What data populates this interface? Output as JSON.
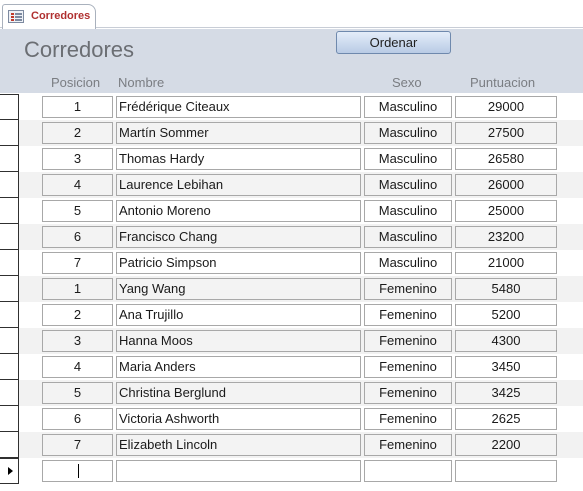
{
  "tab": {
    "label": "Corredores",
    "icon": "form-icon"
  },
  "form": {
    "title": "Corredores",
    "order_button": "Ordenar"
  },
  "columns": [
    "Posicion",
    "Nombre",
    "Sexo",
    "Puntuacion"
  ],
  "rows": [
    {
      "posicion": "1",
      "nombre": "Frédérique Citeaux",
      "sexo": "Masculino",
      "puntuacion": "29000"
    },
    {
      "posicion": "2",
      "nombre": "Martín Sommer",
      "sexo": "Masculino",
      "puntuacion": "27500"
    },
    {
      "posicion": "3",
      "nombre": "Thomas Hardy",
      "sexo": "Masculino",
      "puntuacion": "26580"
    },
    {
      "posicion": "4",
      "nombre": "Laurence Lebihan",
      "sexo": "Masculino",
      "puntuacion": "26000"
    },
    {
      "posicion": "5",
      "nombre": "Antonio Moreno",
      "sexo": "Masculino",
      "puntuacion": "25000"
    },
    {
      "posicion": "6",
      "nombre": "Francisco Chang",
      "sexo": "Masculino",
      "puntuacion": "23200"
    },
    {
      "posicion": "7",
      "nombre": "Patricio Simpson",
      "sexo": "Masculino",
      "puntuacion": "21000"
    },
    {
      "posicion": "1",
      "nombre": "Yang Wang",
      "sexo": "Femenino",
      "puntuacion": "5480"
    },
    {
      "posicion": "2",
      "nombre": "Ana Trujillo",
      "sexo": "Femenino",
      "puntuacion": "5200"
    },
    {
      "posicion": "3",
      "nombre": "Hanna Moos",
      "sexo": "Femenino",
      "puntuacion": "4300"
    },
    {
      "posicion": "4",
      "nombre": "Maria Anders",
      "sexo": "Femenino",
      "puntuacion": "3450"
    },
    {
      "posicion": "5",
      "nombre": "Christina Berglund",
      "sexo": "Femenino",
      "puntuacion": "3425"
    },
    {
      "posicion": "6",
      "nombre": "Victoria Ashworth",
      "sexo": "Femenino",
      "puntuacion": "2625"
    },
    {
      "posicion": "7",
      "nombre": "Elizabeth Lincoln",
      "sexo": "Femenino",
      "puntuacion": "2200"
    }
  ],
  "colors": {
    "tab_text": "#b03030",
    "header_bg": "#d5dbe5",
    "alt_row_bg": "#f2f2f2"
  }
}
